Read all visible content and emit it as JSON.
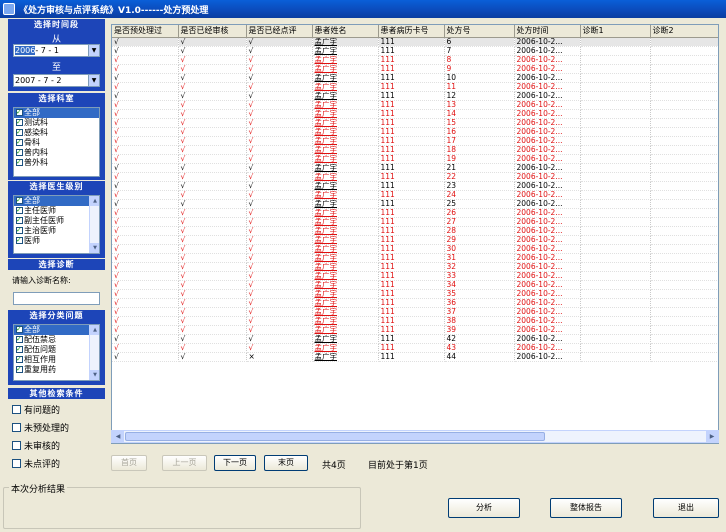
{
  "window": {
    "title": "《处方审核与点评系统》V1.0------处方预处理"
  },
  "left": {
    "time_header": "选择时间段",
    "from_label": "从",
    "from_date_sel": "2006",
    "from_date_rest": "- 7 - 1",
    "to_label": "至",
    "to_date": "2007 - 7 - 2",
    "dept_header": "选择科室",
    "departments": [
      "全部",
      "测试科",
      "感染科",
      "骨科",
      "普内科",
      "普外科"
    ],
    "doctor_header": "选择医生级别",
    "doctor_levels": [
      "全部",
      "主任医师",
      "副主任医师",
      "主治医师",
      "医师"
    ],
    "diag_header": "选择诊断",
    "diag_label": "请输入诊断名称:",
    "diag_value": "",
    "problem_header": "选择分类问题",
    "problems": [
      "全部",
      "配伍禁忌",
      "配伍问题",
      "相互作用",
      "重复用药"
    ],
    "other_header": "其他检索条件",
    "other_options": [
      "有问题的",
      "未预处理的",
      "未审核的",
      "未点评的"
    ]
  },
  "grid": {
    "columns": [
      "是否预处理过",
      "是否已经审核",
      "是否已经点评",
      "患者姓名",
      "患者病历卡号",
      "处方号",
      "处方时间",
      "诊断1",
      "诊断2"
    ],
    "check": "√",
    "cross": "×",
    "rows": [
      {
        "pre": "√",
        "aud": "√",
        "com": "√",
        "name": "孟广宇",
        "card": "111",
        "rx": "6",
        "time": "2006-10-2...",
        "red": false
      },
      {
        "pre": "√",
        "aud": "√",
        "com": "√",
        "name": "孟广宇",
        "card": "111",
        "rx": "7",
        "time": "2006-10-2...",
        "red": false
      },
      {
        "pre": "√",
        "aud": "√",
        "com": "√",
        "name": "孟广宇",
        "card": "111",
        "rx": "8",
        "time": "2006-10-2...",
        "red": true
      },
      {
        "pre": "√",
        "aud": "√",
        "com": "√",
        "name": "孟广宇",
        "card": "111",
        "rx": "9",
        "time": "2006-10-2...",
        "red": true
      },
      {
        "pre": "√",
        "aud": "√",
        "com": "√",
        "name": "孟广宇",
        "card": "111",
        "rx": "10",
        "time": "2006-10-2...",
        "red": false
      },
      {
        "pre": "√",
        "aud": "√",
        "com": "√",
        "name": "孟广宇",
        "card": "111",
        "rx": "11",
        "time": "2006-10-2...",
        "red": true
      },
      {
        "pre": "√",
        "aud": "√",
        "com": "√",
        "name": "孟广宇",
        "card": "111",
        "rx": "12",
        "time": "2006-10-2...",
        "red": false
      },
      {
        "pre": "√",
        "aud": "√",
        "com": "√",
        "name": "孟广宇",
        "card": "111",
        "rx": "13",
        "time": "2006-10-2...",
        "red": true
      },
      {
        "pre": "√",
        "aud": "√",
        "com": "√",
        "name": "孟广宇",
        "card": "111",
        "rx": "14",
        "time": "2006-10-2...",
        "red": true
      },
      {
        "pre": "√",
        "aud": "√",
        "com": "√",
        "name": "孟广宇",
        "card": "111",
        "rx": "15",
        "time": "2006-10-2...",
        "red": true
      },
      {
        "pre": "√",
        "aud": "√",
        "com": "√",
        "name": "孟广宇",
        "card": "111",
        "rx": "16",
        "time": "2006-10-2...",
        "red": true
      },
      {
        "pre": "√",
        "aud": "√",
        "com": "√",
        "name": "孟广宇",
        "card": "111",
        "rx": "17",
        "time": "2006-10-2...",
        "red": true
      },
      {
        "pre": "√",
        "aud": "√",
        "com": "√",
        "name": "孟广宇",
        "card": "111",
        "rx": "18",
        "time": "2006-10-2...",
        "red": true
      },
      {
        "pre": "√",
        "aud": "√",
        "com": "√",
        "name": "孟广宇",
        "card": "111",
        "rx": "19",
        "time": "2006-10-2...",
        "red": true
      },
      {
        "pre": "√",
        "aud": "√",
        "com": "√",
        "name": "孟广宇",
        "card": "111",
        "rx": "21",
        "time": "2006-10-2...",
        "red": false
      },
      {
        "pre": "√",
        "aud": "√",
        "com": "√",
        "name": "孟广宇",
        "card": "111",
        "rx": "22",
        "time": "2006-10-2...",
        "red": true
      },
      {
        "pre": "√",
        "aud": "√",
        "com": "√",
        "name": "孟广宇",
        "card": "111",
        "rx": "23",
        "time": "2006-10-2...",
        "red": false
      },
      {
        "pre": "√",
        "aud": "√",
        "com": "√",
        "name": "孟广宇",
        "card": "111",
        "rx": "24",
        "time": "2006-10-2...",
        "red": true
      },
      {
        "pre": "√",
        "aud": "√",
        "com": "√",
        "name": "孟广宇",
        "card": "111",
        "rx": "25",
        "time": "2006-10-2...",
        "red": false
      },
      {
        "pre": "√",
        "aud": "√",
        "com": "√",
        "name": "孟广宇",
        "card": "111",
        "rx": "26",
        "time": "2006-10-2...",
        "red": true
      },
      {
        "pre": "√",
        "aud": "√",
        "com": "√",
        "name": "孟广宇",
        "card": "111",
        "rx": "27",
        "time": "2006-10-2...",
        "red": true
      },
      {
        "pre": "√",
        "aud": "√",
        "com": "√",
        "name": "孟广宇",
        "card": "111",
        "rx": "28",
        "time": "2006-10-2...",
        "red": true
      },
      {
        "pre": "√",
        "aud": "√",
        "com": "√",
        "name": "孟广宇",
        "card": "111",
        "rx": "29",
        "time": "2006-10-2...",
        "red": true
      },
      {
        "pre": "√",
        "aud": "√",
        "com": "√",
        "name": "孟广宇",
        "card": "111",
        "rx": "30",
        "time": "2006-10-2...",
        "red": true
      },
      {
        "pre": "√",
        "aud": "√",
        "com": "√",
        "name": "孟广宇",
        "card": "111",
        "rx": "31",
        "time": "2006-10-2...",
        "red": true
      },
      {
        "pre": "√",
        "aud": "√",
        "com": "√",
        "name": "孟广宇",
        "card": "111",
        "rx": "32",
        "time": "2006-10-2...",
        "red": true
      },
      {
        "pre": "√",
        "aud": "√",
        "com": "√",
        "name": "孟广宇",
        "card": "111",
        "rx": "33",
        "time": "2006-10-2...",
        "red": true
      },
      {
        "pre": "√",
        "aud": "√",
        "com": "√",
        "name": "孟广宇",
        "card": "111",
        "rx": "34",
        "time": "2006-10-2...",
        "red": true
      },
      {
        "pre": "√",
        "aud": "√",
        "com": "√",
        "name": "孟广宇",
        "card": "111",
        "rx": "35",
        "time": "2006-10-2...",
        "red": true
      },
      {
        "pre": "√",
        "aud": "√",
        "com": "√",
        "name": "孟广宇",
        "card": "111",
        "rx": "36",
        "time": "2006-10-2...",
        "red": true
      },
      {
        "pre": "√",
        "aud": "√",
        "com": "√",
        "name": "孟广宇",
        "card": "111",
        "rx": "37",
        "time": "2006-10-2...",
        "red": true
      },
      {
        "pre": "√",
        "aud": "√",
        "com": "√",
        "name": "孟广宇",
        "card": "111",
        "rx": "38",
        "time": "2006-10-2...",
        "red": true
      },
      {
        "pre": "√",
        "aud": "√",
        "com": "√",
        "name": "孟广宇",
        "card": "111",
        "rx": "39",
        "time": "2006-10-2...",
        "red": true
      },
      {
        "pre": "√",
        "aud": "√",
        "com": "√",
        "name": "孟广宇",
        "card": "111",
        "rx": "42",
        "time": "2006-10-2...",
        "red": false
      },
      {
        "pre": "√",
        "aud": "√",
        "com": "√",
        "name": "孟广宇",
        "card": "111",
        "rx": "43",
        "time": "2006-10-2...",
        "red": true
      },
      {
        "pre": "√",
        "aud": "√",
        "com": "×",
        "name": "孟广宇",
        "card": "111",
        "rx": "44",
        "time": "2006-10-2...",
        "red": false
      }
    ]
  },
  "pager": {
    "first": "首页",
    "prev": "上一页",
    "next": "下一页",
    "last": "末页",
    "total": "共4页",
    "current": "目前处于第1页"
  },
  "results": {
    "legend": "本次分析结果"
  },
  "actions": {
    "analyze": "分析",
    "report": "整体报告",
    "exit": "退出"
  },
  "colors": {
    "panel_blue": "#1d45b8",
    "red_row": "#e01010",
    "selection": "#316ac5"
  }
}
